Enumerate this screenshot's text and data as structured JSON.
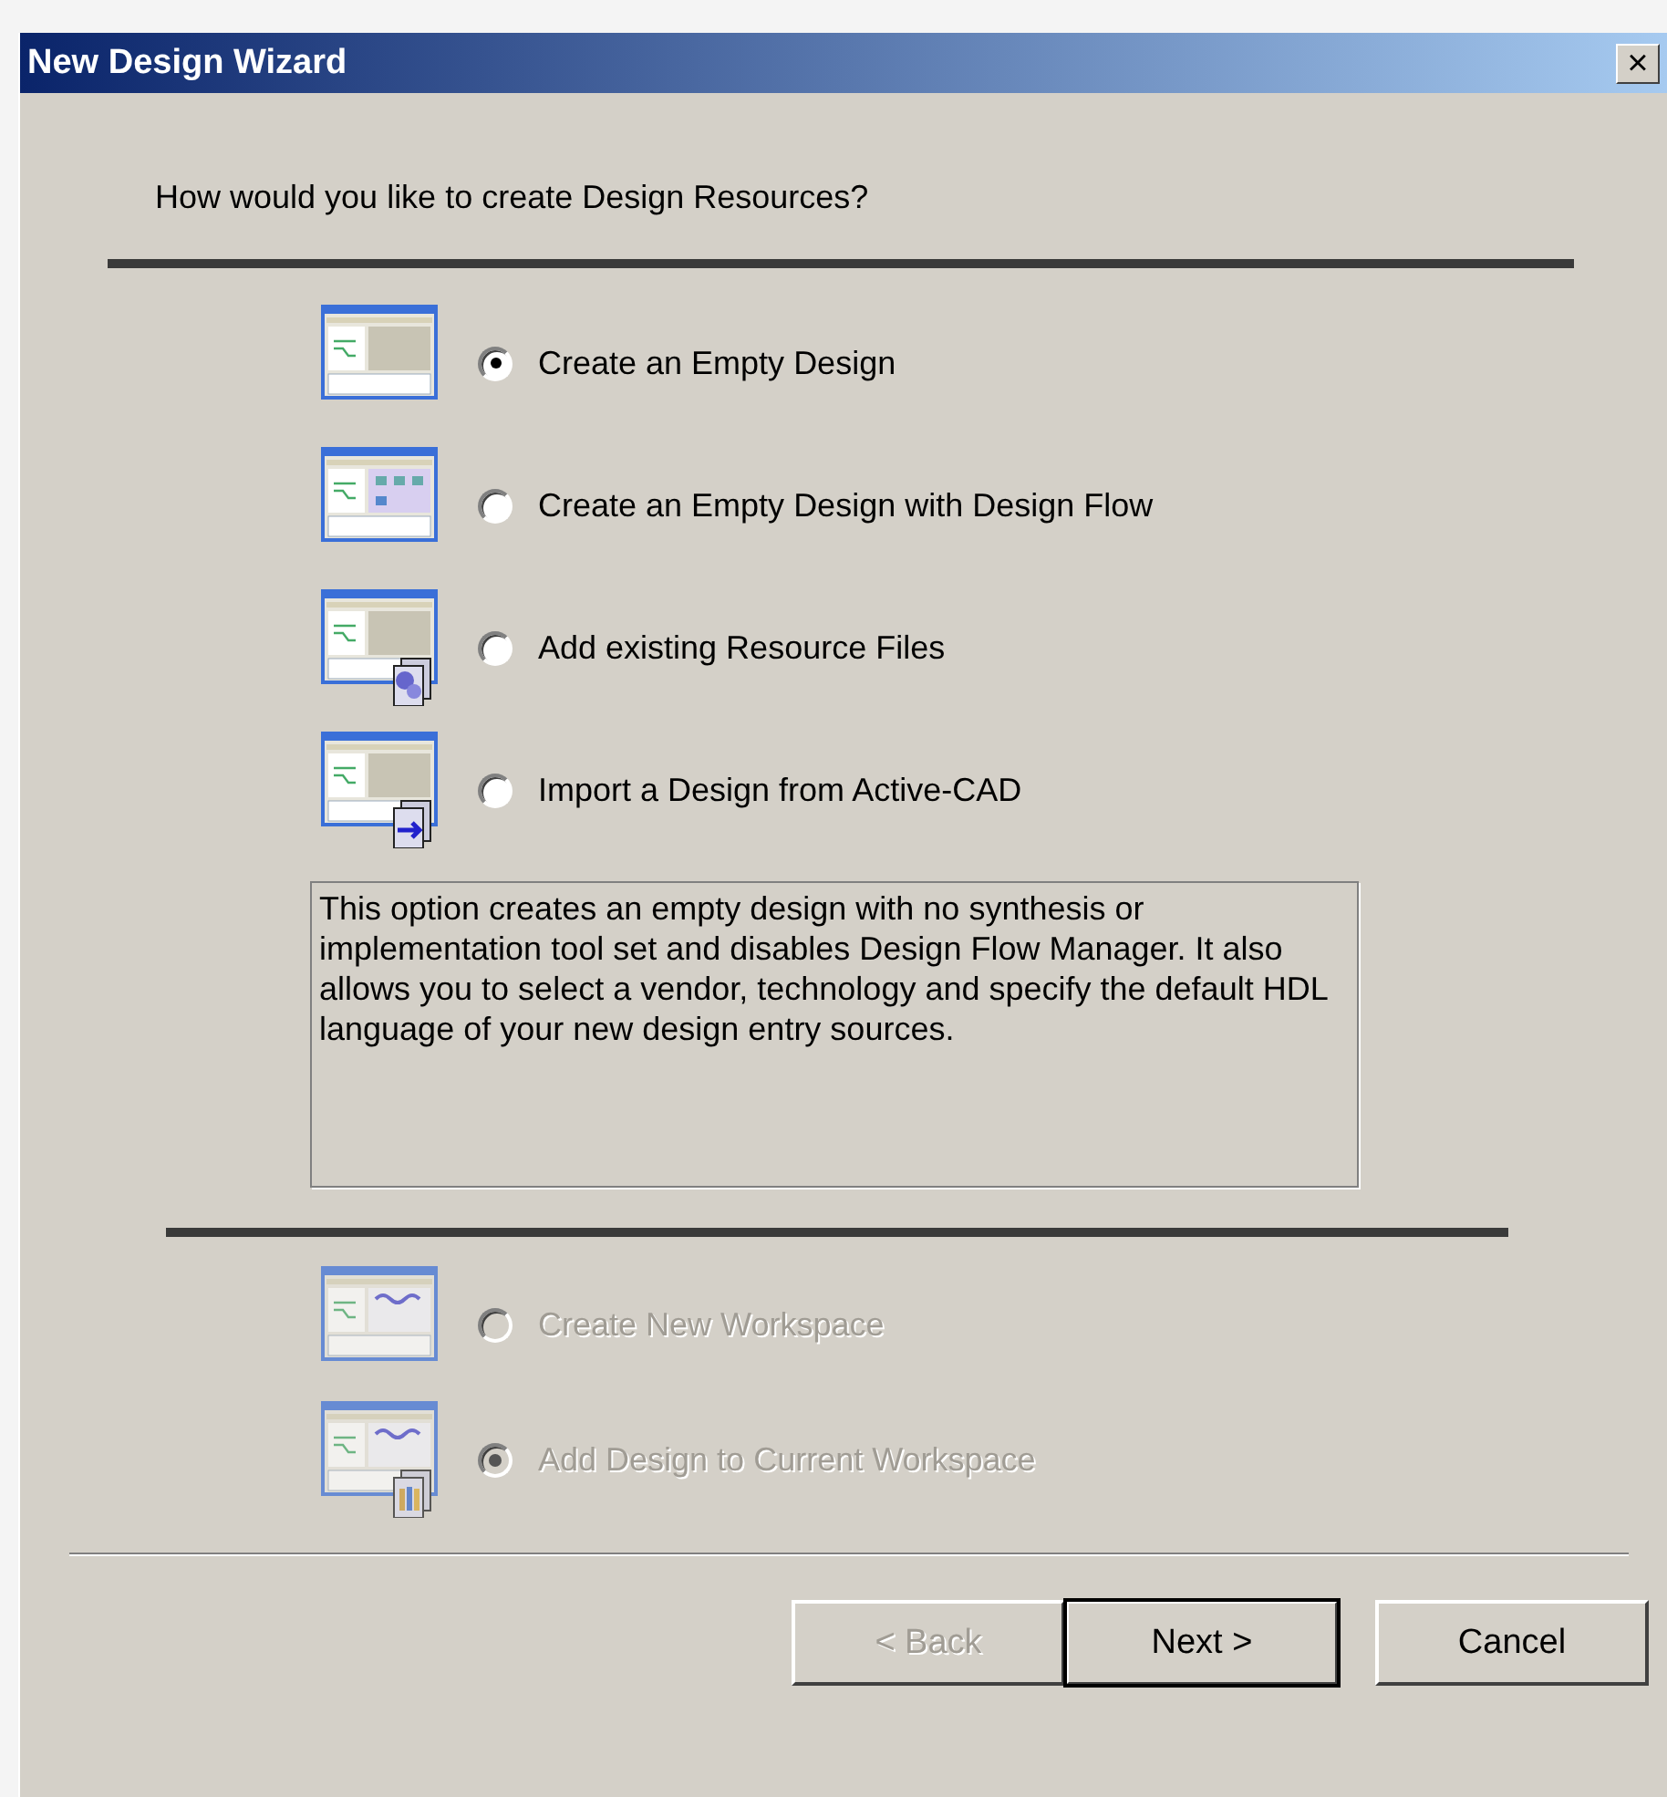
{
  "window": {
    "title": "New Design Wizard",
    "close": "×"
  },
  "question": "How would you like to create Design Resources?",
  "options": [
    {
      "label": "Create an Empty Design",
      "selected": true,
      "disabled": false,
      "kind": "empty"
    },
    {
      "label": "Create an Empty Design with Design Flow",
      "selected": false,
      "disabled": false,
      "kind": "flow"
    },
    {
      "label": "Add existing Resource Files",
      "selected": false,
      "disabled": false,
      "kind": "files"
    },
    {
      "label": "Import a Design from Active-CAD",
      "selected": false,
      "disabled": false,
      "kind": "import"
    }
  ],
  "description": "This option creates an empty design with no synthesis or implementation tool set and disables Design Flow Manager. It also allows you to select a vendor, technology and specify the default HDL language of your new design entry sources.",
  "workspace_options": [
    {
      "label": "Create New Workspace",
      "selected": false,
      "disabled": true,
      "kind": "schematic"
    },
    {
      "label": "Add Design to Current Workspace",
      "selected": true,
      "disabled": true,
      "kind": "books"
    }
  ],
  "buttons": [
    {
      "label": "< Back",
      "disabled": true,
      "default": false
    },
    {
      "label": "Next >",
      "disabled": false,
      "default": true
    },
    {
      "label": "Cancel",
      "disabled": false,
      "default": false
    }
  ]
}
